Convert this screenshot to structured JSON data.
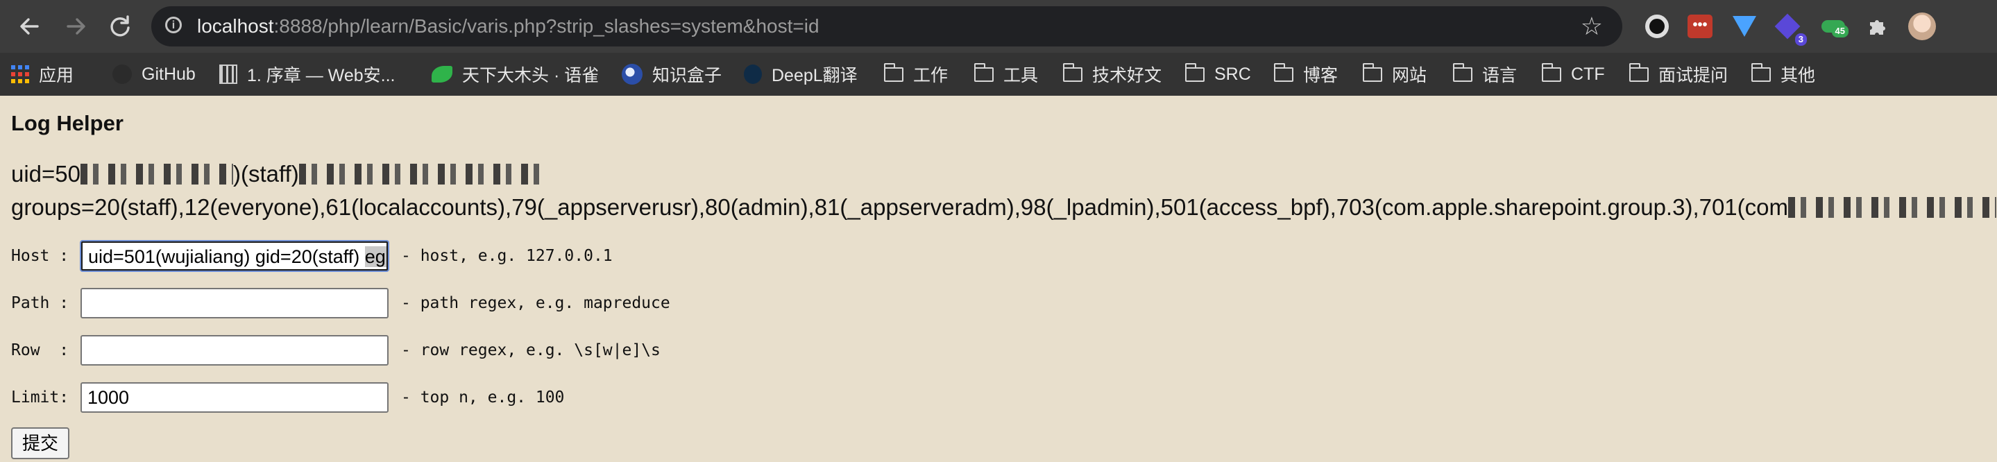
{
  "browser": {
    "url_host": "localhost",
    "url_rest": ":8888/php/learn/Basic/varis.php?strip_slashes=system&host=id",
    "extensions": [
      {
        "name": "circle-extension",
        "color": "#111111",
        "badge": ""
      },
      {
        "name": "dots-extension",
        "color": "#c0392b",
        "badge": ""
      },
      {
        "name": "diamond-extension",
        "color": "#4aa3ff",
        "badge": ""
      },
      {
        "name": "cube-extension",
        "color": "#5a48d8",
        "badge": "3"
      },
      {
        "name": "toggle-extension",
        "color": "#35a853",
        "badge": "45"
      }
    ],
    "bookmarks": [
      {
        "label": "应用",
        "icon": "apps-grid-icon"
      },
      {
        "label": "GitHub",
        "icon": "github-icon"
      },
      {
        "label": "1. 序章 — Web安...",
        "icon": "book-icon"
      },
      {
        "label": "天下大木头 · 语雀",
        "icon": "yuque-icon"
      },
      {
        "label": "知识盒子",
        "icon": "globe-icon"
      },
      {
        "label": "DeepL翻译",
        "icon": "deepl-icon"
      },
      {
        "label": "工作",
        "icon": "folder-icon"
      },
      {
        "label": "工具",
        "icon": "folder-icon"
      },
      {
        "label": "技术好文",
        "icon": "folder-icon"
      },
      {
        "label": "SRC",
        "icon": "folder-icon"
      },
      {
        "label": "博客",
        "icon": "folder-icon"
      },
      {
        "label": "网站",
        "icon": "folder-icon"
      },
      {
        "label": "语言",
        "icon": "folder-icon"
      },
      {
        "label": "CTF",
        "icon": "folder-icon"
      },
      {
        "label": "面试提问",
        "icon": "folder-icon"
      },
      {
        "label": "其他",
        "icon": "folder-icon"
      }
    ]
  },
  "page": {
    "title": "Log Helper",
    "output_line1_prefix": "uid=50",
    "output_line1_mid": ")(staff)",
    "output_line2": "groups=20(staff),12(everyone),61(localaccounts),79(_appserverusr),80(admin),81(_appserveradm),98(_lpadmin),501(access_bpf),703(com.apple.sharepoint.group.3),701(com",
    "form": {
      "host": {
        "label": "Host :",
        "value": "uid=501(wujialiang) gid=20(staff) ",
        "value_selected": "egi",
        "hint": "- host, e.g. 127.0.0.1"
      },
      "path": {
        "label": "Path :",
        "value": "",
        "hint": "- path regex, e.g. mapreduce"
      },
      "row": {
        "label": "Row  :",
        "value": "",
        "hint": "- row regex, e.g. \\s[w|e]\\s"
      },
      "limit": {
        "label": "Limit:",
        "value": "1000",
        "hint": "- top n, e.g. 100"
      },
      "submit_label": "提交"
    }
  }
}
